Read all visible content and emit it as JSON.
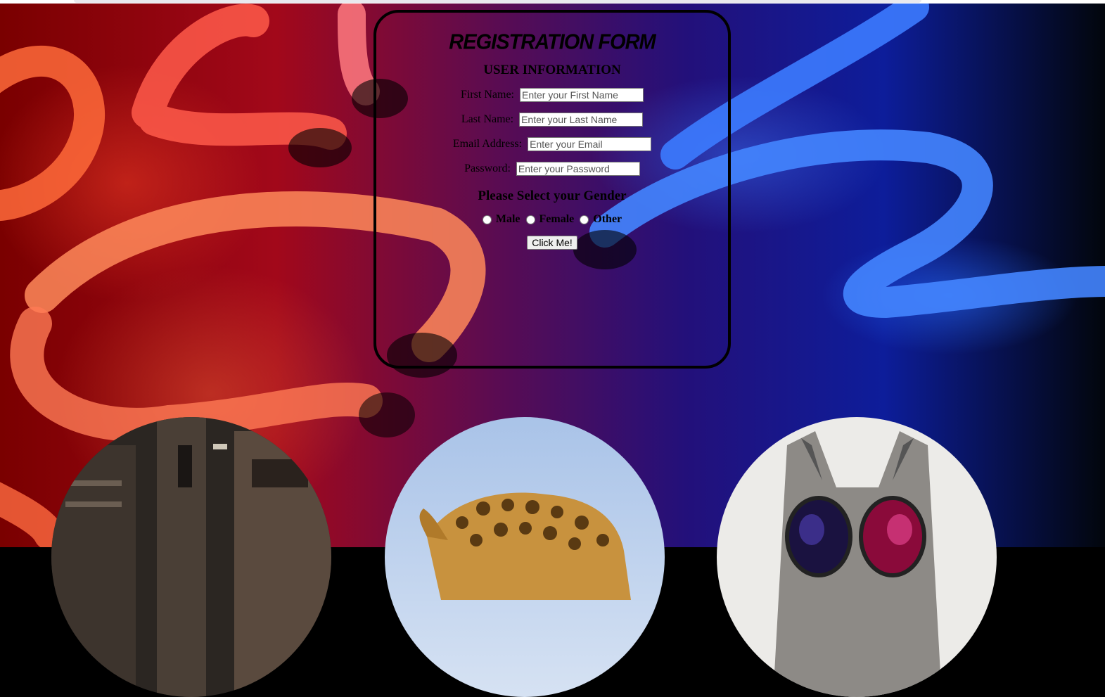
{
  "form": {
    "title": "REGISTRATION FORM",
    "section_heading": "USER INFORMATION",
    "fields": [
      {
        "label": "First Name:",
        "placeholder": "Enter your First Name"
      },
      {
        "label": "Last Name:",
        "placeholder": "Enter your Last Name"
      },
      {
        "label": "Email Address:",
        "placeholder": "Enter your Email"
      },
      {
        "label": "Password:",
        "placeholder": "Enter your Password"
      }
    ],
    "gender_heading": "Please Select your Gender",
    "gender_options": [
      "Male",
      "Female",
      "Other"
    ],
    "submit_label": "Click Me!"
  },
  "colors": {
    "background_left": "#a2081a",
    "background_right": "#0d1d9a",
    "form_border": "#000000"
  },
  "images": [
    "building-image",
    "giraffe-image",
    "cat-glasses-image"
  ]
}
